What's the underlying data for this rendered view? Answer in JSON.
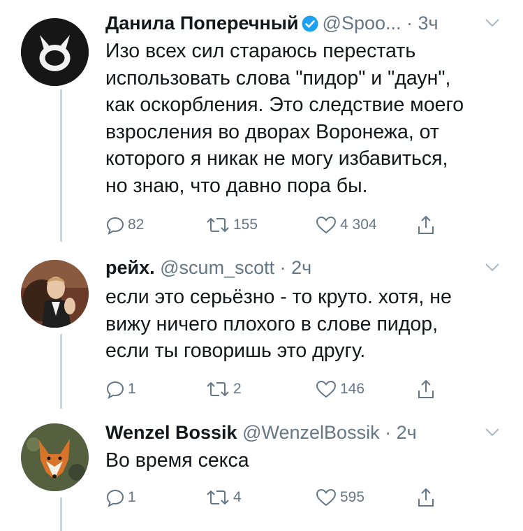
{
  "tweets": [
    {
      "author_name": "Данила Поперечный",
      "verified": true,
      "handle": "@Spoo...",
      "time": "3ч",
      "lines": [
        "Изо всех сил стараюсь перестать",
        "использовать слова \"пидор\" и \"даун\",",
        "как оскорбления. Это следствие моего",
        "взросления во дворах Воронежа, от",
        "которого я никак не могу избавиться,",
        "но знаю, что давно пора бы."
      ],
      "replies": "82",
      "retweets": "155",
      "likes": "4 304"
    },
    {
      "author_name": "рейх.",
      "verified": false,
      "handle": "@scum_scott",
      "time": "2ч",
      "lines": [
        "если это серьёзно - то круто. хотя, не",
        "вижу ничего плохого в слове пидор,",
        "если ты говоришь это другу."
      ],
      "replies": "1",
      "retweets": "2",
      "likes": "146"
    },
    {
      "author_name": "Wenzel Bossik",
      "verified": false,
      "handle": "@WenzelBossik",
      "time": "2ч",
      "lines": [
        "Во время секса"
      ],
      "replies": "1",
      "retweets": "4",
      "likes": "595"
    }
  ],
  "colors": {
    "text": "#14171a",
    "secondary": "#657786",
    "verified": "#1da1f2",
    "thread_line": "#ccd6dd"
  },
  "icons": [
    "reply-icon",
    "retweet-icon",
    "like-icon",
    "share-icon",
    "chevron-down-icon",
    "verified-badge-icon"
  ]
}
